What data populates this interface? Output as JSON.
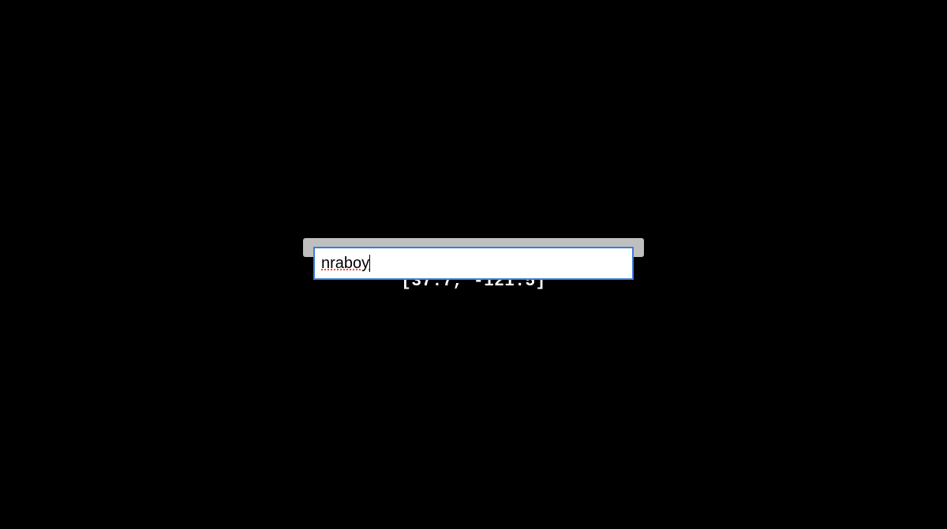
{
  "input": {
    "value": "nraboy",
    "placeholder": ""
  },
  "coordinates": {
    "display": "[37.7, -121.5]",
    "latitude": 37.7,
    "longitude": -121.5
  }
}
